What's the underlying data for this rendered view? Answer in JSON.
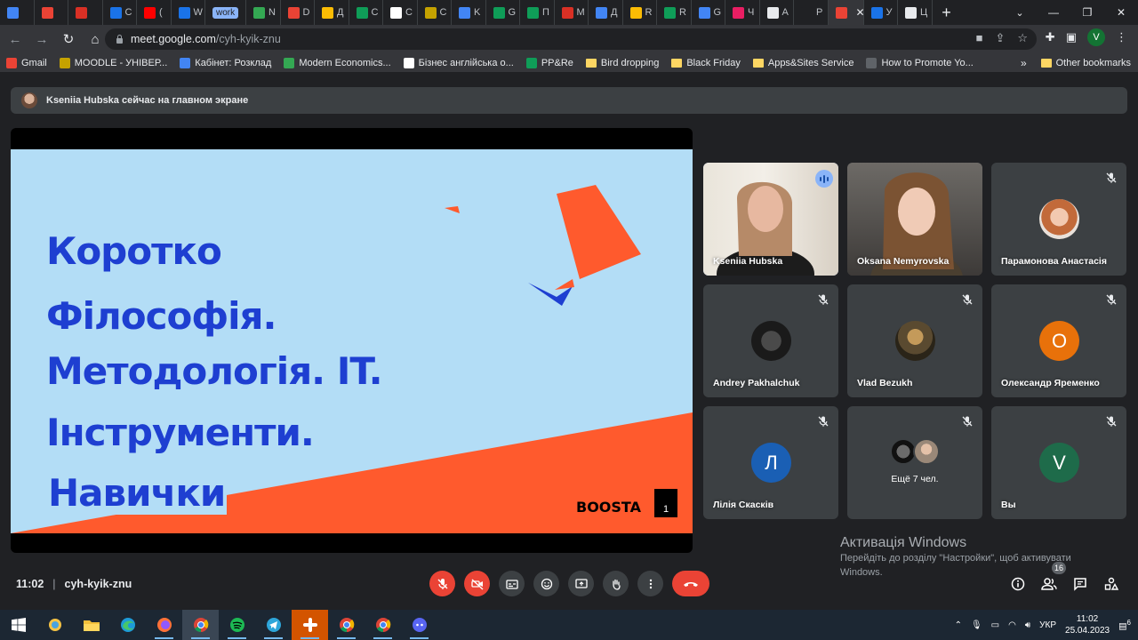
{
  "browser": {
    "tabs": [
      {
        "label": "",
        "color": "#4285f4"
      },
      {
        "label": "",
        "color": "#ea4335"
      },
      {
        "label": "",
        "color": "#d93025"
      },
      {
        "label": "C",
        "color": "#1a73e8"
      },
      {
        "label": "(",
        "color": "#ff0000"
      },
      {
        "label": "W",
        "color": "#1a73e8"
      },
      {
        "label": "work",
        "color": "#8ab4f8",
        "group": true
      },
      {
        "label": "N",
        "color": "#34a853"
      },
      {
        "label": "D",
        "color": "#ea4335"
      },
      {
        "label": "Д",
        "color": "#fbbc04"
      },
      {
        "label": "C",
        "color": "#0f9d58"
      },
      {
        "label": "C",
        "color": "#ffffff"
      },
      {
        "label": "C",
        "color": "#c5a200"
      },
      {
        "label": "K",
        "color": "#4285f4"
      },
      {
        "label": "G",
        "color": "#0f9d58"
      },
      {
        "label": "П",
        "color": "#0f9d58"
      },
      {
        "label": "M",
        "color": "#d93025"
      },
      {
        "label": "Д",
        "color": "#4285f4"
      },
      {
        "label": "R",
        "color": "#fbbc04"
      },
      {
        "label": "R",
        "color": "#0f9d58"
      },
      {
        "label": "G",
        "color": "#4285f4"
      },
      {
        "label": "Ч",
        "color": "#e91e63"
      },
      {
        "label": "A",
        "color": "#e8eaed"
      },
      {
        "label": "P",
        "color": "#202124"
      },
      {
        "label": "",
        "color": "#ea4335",
        "active": true
      },
      {
        "label": "У",
        "color": "#1a73e8"
      },
      {
        "label": "Ц",
        "color": "#e8eaed"
      }
    ],
    "url_host": "meet.google.com",
    "url_path": "/cyh-kyik-znu",
    "profile_initial": "V",
    "bookmarks": [
      {
        "label": "Gmail",
        "color": "#ea4335",
        "type": "site"
      },
      {
        "label": "MOODLE - УНІВЕР...",
        "color": "#c5a200",
        "type": "site"
      },
      {
        "label": "Кабінет: Розклад",
        "color": "#4285f4",
        "type": "site"
      },
      {
        "label": "Modern Economics...",
        "color": "#34a853",
        "type": "site"
      },
      {
        "label": "Бізнес англійська о...",
        "color": "#ffffff",
        "type": "site"
      },
      {
        "label": "PP&Re",
        "color": "#0f9d58",
        "type": "site"
      },
      {
        "label": "Bird dropping",
        "type": "folder"
      },
      {
        "label": "Black Friday",
        "type": "folder"
      },
      {
        "label": "Apps&Sites Service",
        "type": "folder"
      },
      {
        "label": "How to Promote Yo...",
        "color": "#5f6368",
        "type": "site"
      }
    ],
    "bookmarks_more": "»",
    "other_bookmarks": "Other bookmarks"
  },
  "meet": {
    "presenting_banner": "Kseniia Hubska сейчас на главном экране",
    "slide": {
      "lines": [
        "Коротко",
        "Філософія.",
        "Методологія. IT.",
        "Інструменти.",
        "Навички"
      ],
      "brand": "BOOSTA",
      "page_number": "1",
      "colors": {
        "background": "#b3ddf6",
        "text": "#1e3fd1",
        "accent": "#ff5a2d"
      }
    },
    "participants": [
      {
        "name": "Kseniia Hubska",
        "type": "video",
        "speaking": true,
        "muted": false
      },
      {
        "name": "Oksana Nemyrovska",
        "type": "video",
        "speaking": false,
        "muted": false
      },
      {
        "name": "Парамонова Анастасія",
        "type": "photo",
        "muted": true
      },
      {
        "name": "Andrey Pakhalchuk",
        "type": "photo",
        "muted": true
      },
      {
        "name": "Vlad Bezukh",
        "type": "photo",
        "muted": true
      },
      {
        "name": "Олександр Яременко",
        "type": "letter",
        "initial": "О",
        "color": "#e8710a",
        "muted": true
      },
      {
        "name": "Лілія Скаскiв",
        "type": "letter",
        "initial": "Л",
        "color": "#1a5fb4",
        "muted": true
      },
      {
        "name": "Ещё 7 чел.",
        "type": "more",
        "muted": true
      },
      {
        "name": "Вы",
        "type": "letter",
        "initial": "V",
        "color": "#1e6b4a",
        "muted": true
      }
    ],
    "time": "11:02",
    "meeting_code": "cyh-kyik-znu",
    "people_count": "16",
    "windows_activation": {
      "title": "Активація Windows",
      "text": "Перейдіть до розділу \"Настройки\", щоб активувати Windows."
    }
  },
  "taskbar": {
    "language": "УКР",
    "time": "11:02",
    "date": "25.04.2023",
    "notifications": "6"
  }
}
